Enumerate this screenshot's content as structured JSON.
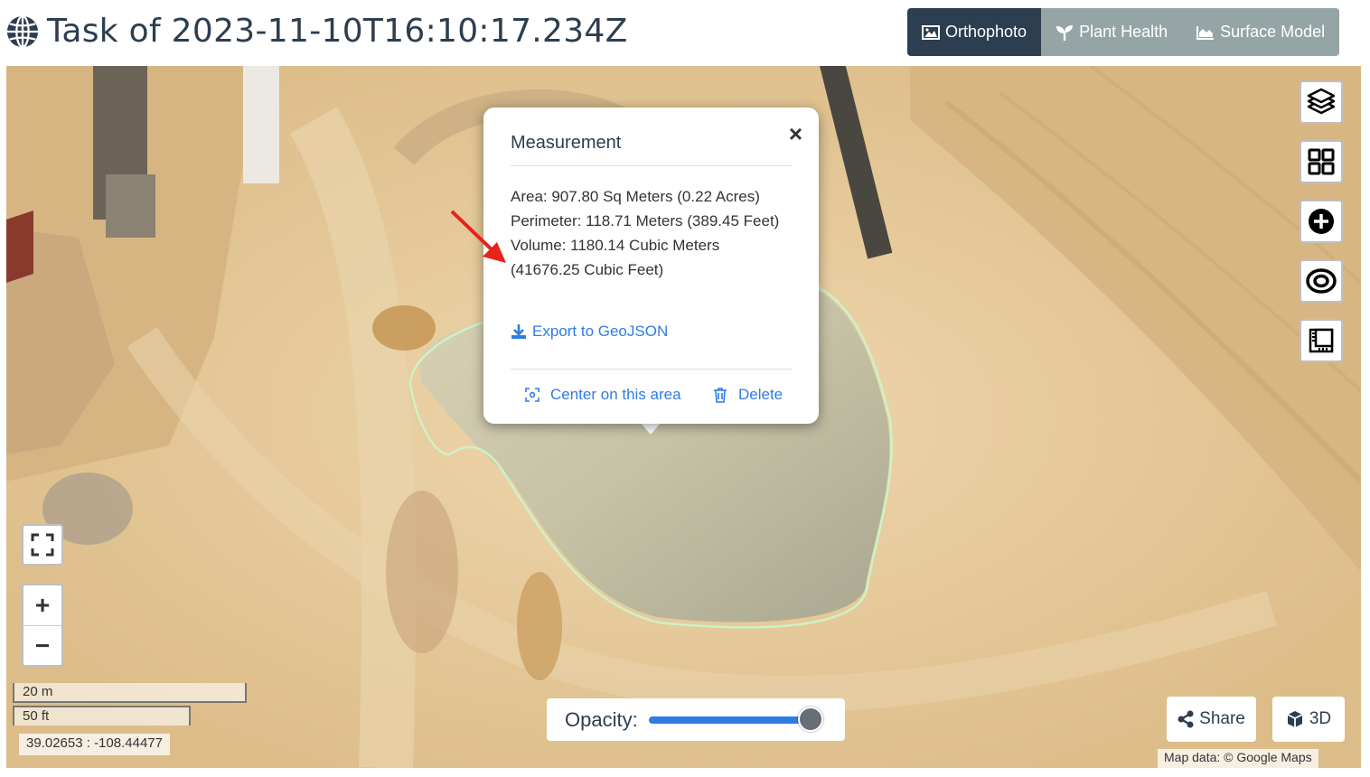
{
  "header": {
    "title": "Task of 2023-11-10T16:10:17.234Z",
    "tabs": [
      {
        "label": "Orthophoto",
        "active": true
      },
      {
        "label": "Plant Health",
        "active": false
      },
      {
        "label": "Surface Model",
        "active": false
      }
    ]
  },
  "map": {
    "scale_metric": "20 m",
    "scale_imperial": "50 ft",
    "coordinates": "39.02653 : -108.44477",
    "attribution": "Map data: © Google Maps",
    "opacity_label": "Opacity:",
    "opacity_value": 1.0,
    "share_label": "Share",
    "three_d_label": "3D"
  },
  "popup": {
    "title": "Measurement",
    "area": "Area: 907.80 Sq Meters (0.22 Acres)",
    "perimeter": "Perimeter: 118.71 Meters (389.45 Feet)",
    "volume": "Volume: 1180.14 Cubic Meters (41676.25 Cubic Feet)",
    "export_label": "Export to GeoJSON",
    "center_label": "Center on this area",
    "delete_label": "Delete"
  },
  "colors": {
    "accent": "#2f7de1",
    "header_active": "#2c3e50",
    "header_inactive": "#95a5a6",
    "measurement_outline": "#c8f0c0",
    "arrow": "#e8231a"
  }
}
